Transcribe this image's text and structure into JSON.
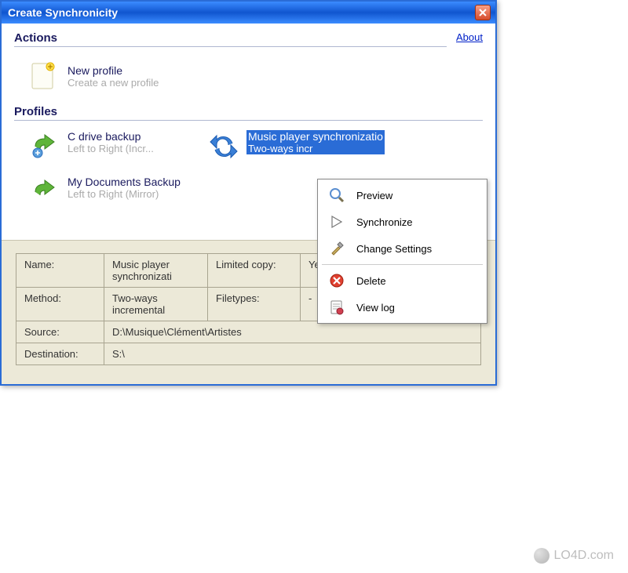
{
  "window": {
    "title": "Create Synchronicity",
    "about": "About"
  },
  "sections": {
    "actions": "Actions",
    "profiles": "Profiles"
  },
  "new_profile": {
    "title": "New profile",
    "sub": "Create a new profile"
  },
  "profiles": {
    "c_drive": {
      "title": "C drive backup",
      "sub": "Left to Right (Incr..."
    },
    "my_docs": {
      "title": "My Documents Backup",
      "sub": "Left to Right (Mirror)"
    },
    "music": {
      "title": "Music player synchronizatio",
      "sub": "Two-ways incr"
    }
  },
  "menu": {
    "preview": "Preview",
    "synchronize": "Synchronize",
    "change_settings": "Change Settings",
    "delete": "Delete",
    "view_log": "View log"
  },
  "details": {
    "name_label": "Name:",
    "name_val": "Music player synchronizati",
    "limited_label": "Limited copy:",
    "limited_val": "Yes",
    "method_label": "Method:",
    "method_val": "Two-ways incremental",
    "filetypes_label": "Filetypes:",
    "filetypes_val": "-",
    "source_label": "Source:",
    "source_val": "D:\\Musique\\Clément\\Artistes",
    "dest_label": "Destination:",
    "dest_val": "S:\\"
  },
  "watermark": "LO4D.com"
}
